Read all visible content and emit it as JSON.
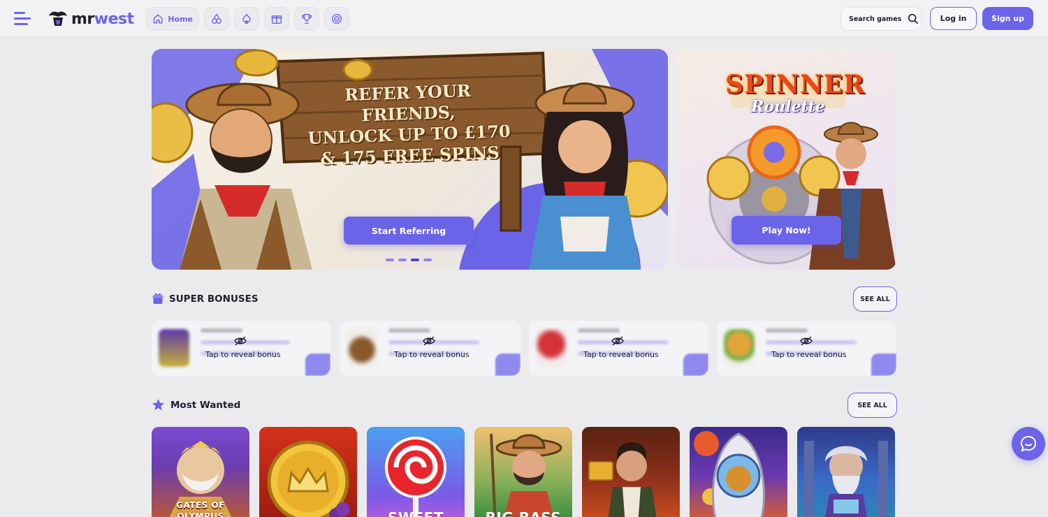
{
  "header": {
    "brand": {
      "mr": "mr",
      "west": "west"
    },
    "nav": [
      {
        "label": "Home",
        "icon": "home-icon"
      },
      {
        "label": "",
        "icon": "cherries-icon"
      },
      {
        "label": "",
        "icon": "spade-icon"
      },
      {
        "label": "",
        "icon": "gift-icon"
      },
      {
        "label": "",
        "icon": "trophy-icon"
      },
      {
        "label": "",
        "icon": "target-icon"
      }
    ],
    "search_label": "Search games",
    "login_label": "Log in",
    "signup_label": "Sign up"
  },
  "banners": {
    "main": {
      "lines": [
        "REFER YOUR FRIENDS,",
        "UNLOCK UP TO £170",
        "& 175 FREE SPINS"
      ],
      "cta": "Start Referring",
      "slides": 4,
      "active_slide": 3
    },
    "side": {
      "title": "SPINNER",
      "subtitle": "Roulette",
      "cta": "Play Now!"
    }
  },
  "super_bonuses": {
    "title": "SUPER BONUSES",
    "see_all": "SEE ALL",
    "cards": [
      {
        "reveal": "Tap to reveal bonus",
        "thumb_color": "#5b3aa8"
      },
      {
        "reveal": "Tap to reveal bonus",
        "thumb_color": "#8a5a2b"
      },
      {
        "reveal": "Tap to reveal bonus",
        "thumb_color": "#d3323a"
      },
      {
        "reveal": "Tap to reveal bonus",
        "thumb_color": "#e2a53a"
      }
    ]
  },
  "most_wanted": {
    "title": "Most Wanted",
    "see_all": "SEE ALL",
    "games": [
      {
        "name": "GATES OF OLYMPUS",
        "bg": "#6a3db0"
      },
      {
        "name": "",
        "bg": "#c2260f"
      },
      {
        "name": "SWEET",
        "bg": "#3a6fe0"
      },
      {
        "name": "BIG BASS",
        "bg": "#2e8a3a"
      },
      {
        "name": "",
        "bg": "#8a2f1c"
      },
      {
        "name": "",
        "bg": "#3b2a8a"
      },
      {
        "name": "",
        "bg": "#2e3b8a"
      }
    ]
  },
  "colors": {
    "accent": "#6b64e8",
    "background": "#ebebee"
  }
}
